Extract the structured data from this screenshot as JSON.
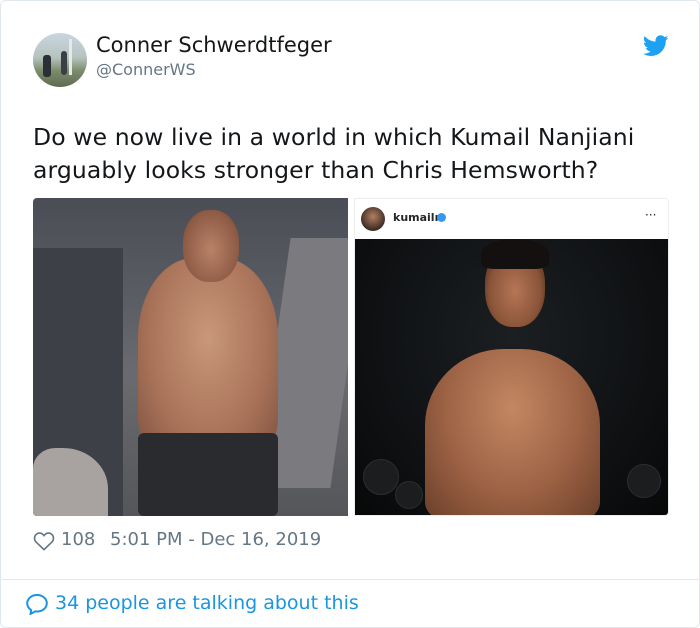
{
  "author": {
    "name": "Conner Schwerdtfeger",
    "handle": "@ConnerWS"
  },
  "tweet": {
    "text_line1": "Do we now live in a world in which Kumail Nanjiani",
    "text_line2": "arguably looks stronger than Chris Hemsworth?"
  },
  "embedded_instagram": {
    "username": "kumailn",
    "more_label": "···"
  },
  "stats": {
    "likes": "108",
    "timestamp": "5:01 PM - Dec 16, 2019"
  },
  "footer": {
    "conversation_label": "34 people are talking about this"
  },
  "icons": {
    "brand": "twitter-bird-icon",
    "like": "heart-icon",
    "reply": "speech-bubble-icon",
    "verified": "verified-badge-icon"
  },
  "colors": {
    "twitter_blue": "#1da1f2",
    "link_blue": "#1b95e0",
    "text_primary": "#14171a",
    "text_secondary": "#657786",
    "border": "#e1e8ed"
  }
}
